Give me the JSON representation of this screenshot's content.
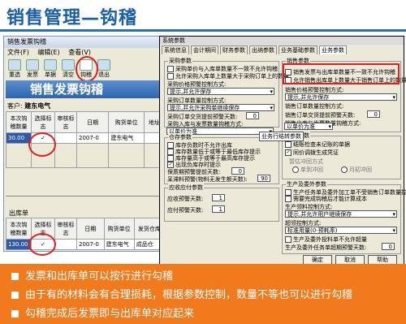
{
  "slide": {
    "title": "销售管理—钩稽"
  },
  "app": {
    "window_title": "销售发票钩稽",
    "menu": [
      "文件(F)",
      "编辑(E)",
      "查看(V)"
    ],
    "toolbar": [
      "重选",
      "发票",
      "单据",
      "清空",
      "钩稽",
      "退出"
    ],
    "banner": "销售发票钩稽",
    "customer_label": "客户:",
    "customer_value": "建东电气",
    "invoice_table": {
      "headers": [
        "本次钩稽数量",
        "选择标志",
        "审核标志",
        "日期",
        "购货单位",
        "地址"
      ],
      "row": [
        "30.00",
        "✓",
        "",
        "2007-0",
        "建东电气",
        ""
      ]
    },
    "out_label": "出库单",
    "out_table": {
      "headers": [
        "本次钩稽数量",
        "选择标志",
        "审核标志",
        "日期",
        "购货单位",
        "发货仓库"
      ],
      "row": [
        "130.00",
        "✓",
        "",
        "2007-0",
        "建东电气",
        "成品仓"
      ]
    }
  },
  "dialog": {
    "title": "系统参数",
    "tabs": [
      "系统信息",
      "会计期间",
      "财务参数",
      "出纳参数",
      "业务基础参数",
      "业务参数"
    ],
    "purchase": {
      "title": "采购参数",
      "cb1": "采购单价与入库单数量不一致不允许钩稽",
      "cb2": "允许采购入库单上数量大于采购订单上的数量",
      "lbl_price": "采购价格预警控制方式:",
      "sel_price": "提示,并允许保存",
      "lbl_ctl": "采购订单数量控制方式:",
      "sel_ctl": "提示,并允许采购单继续保存",
      "lbl_days": "采购订单交货提前预警天数:",
      "days_val": "0",
      "lbl_limit": "采购入库与发票数量钩稽方式:",
      "sel_limit": "以单价为准"
    },
    "sales": {
      "title": "销售参数",
      "cb1": "销售发票与出库单数量不一致不允许钩稽",
      "cb2": "允许销售出库单上数量大于销售订单上的数量",
      "lbl_price": "销售价格预警控制方式:",
      "sel_price": "提示,并允许保存",
      "lbl_ctl": "销售订单数量控制方式:",
      "lbl_days": "销售订单交货提前预警天数:",
      "days_val": "0",
      "lbl_limit": "销售出库与发票数量钩稽方式:",
      "sel_limit": "以单价为准"
    },
    "stock": {
      "title": "仓存参数",
      "cb1": "库存负数时不允许出库",
      "cb2": "库存数量低于或等于最低库存提示",
      "cb3": "库存量高于或等于最高库存提示",
      "cb4": "出现负库存时提示",
      "lbl_days": "保质期预警提前天数:",
      "days_val": "0",
      "lbl_age": "呆滞料预警(物料无发生额天数):",
      "age_val": "90"
    },
    "check": {
      "title": "核算参数",
      "cb1": "结账检查未记账的单据",
      "cb2": "同价调拨生成凭证",
      "lbl_mode": "暂估冲回方式",
      "r1": "单到冲回",
      "r2": "月初冲回",
      "tag": "业务行结转参数"
    },
    "receivable": {
      "title": "应收应付参数",
      "lbl1": "应收预警天数:",
      "val1": "1",
      "lbl2": "应付预警天数:",
      "val2": "1"
    },
    "production": {
      "title": "生产及委外参数",
      "cb1": "生产任务单及委外加工单不受销售订单数量控制",
      "cb2": "需要完成钩稽后才能计算成本",
      "lbl_ctl": "生产领料控制方式:",
      "sel_ctl": "提示,并允许用户继续保存",
      "lbl_over": "超领控制方式:",
      "sel_over": "标准用量(0-预耗率)",
      "cb3": "生产及委外投料单不允许超量",
      "lbl_days": "生产及委外任务单超期预警天数:",
      "days_val": "0"
    },
    "buttons": {
      "ok": "确定",
      "cancel": "取消",
      "help": "帮助"
    }
  },
  "bullets": [
    "发票和出库单可以按行进行勾稽",
    "由于有的材料会有合理损耗，根据参数控制，数量不等也可以进行勾稽",
    "勾稽完成后发票即与出库单对应起来"
  ]
}
